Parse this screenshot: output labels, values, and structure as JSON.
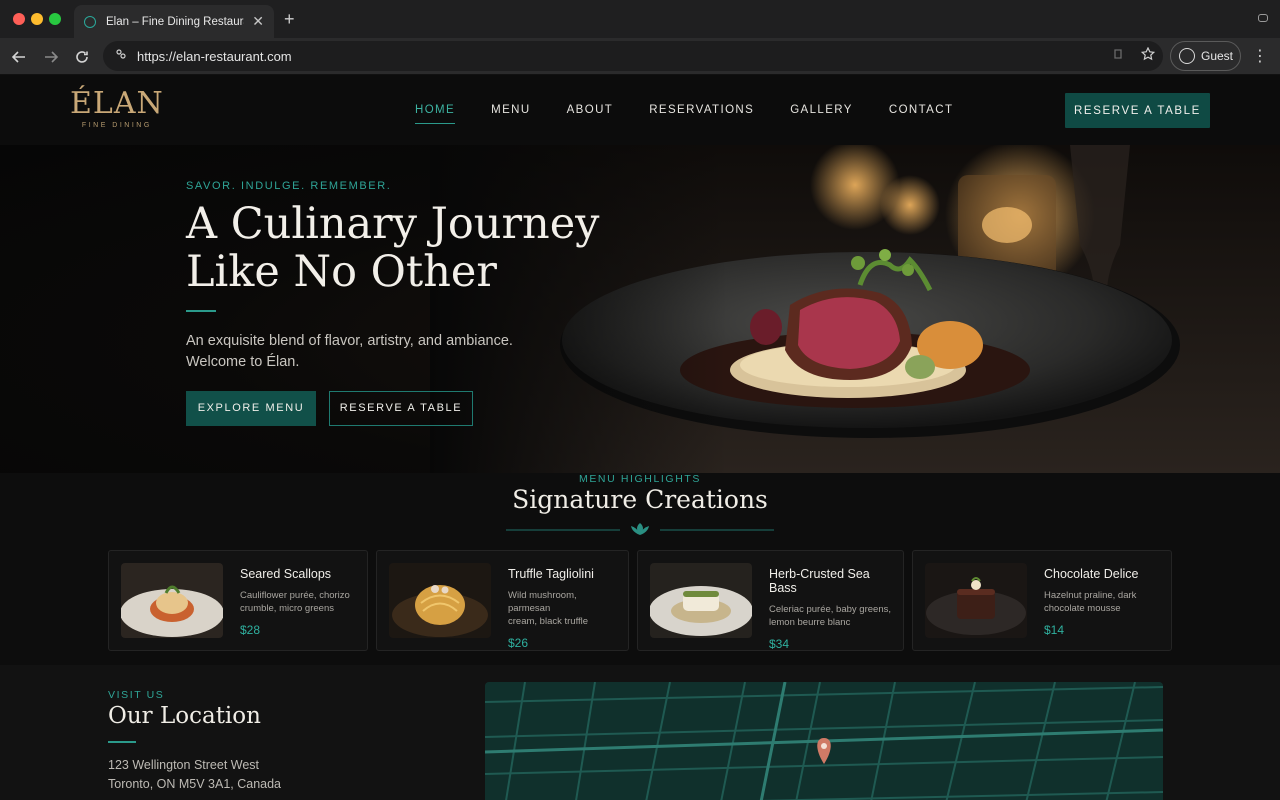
{
  "browser": {
    "tab_title": "Élan – Fine Dining Restaurant",
    "url": "https://elan-restaurant.com",
    "profile_label": "Guest"
  },
  "header": {
    "logo_main": "ÉLAN",
    "logo_sub": "FINE DINING",
    "nav": [
      {
        "label": "HOME",
        "active": true
      },
      {
        "label": "MENU",
        "active": false
      },
      {
        "label": "ABOUT",
        "active": false
      },
      {
        "label": "RESERVATIONS",
        "active": false
      },
      {
        "label": "GALLERY",
        "active": false
      },
      {
        "label": "CONTACT",
        "active": false
      }
    ],
    "cta_label": "RESERVE A TABLE"
  },
  "hero": {
    "eyebrow": "SAVOR. INDULGE. REMEMBER.",
    "title_line1": "A Culinary Journey",
    "title_line2": "Like No Other",
    "subtitle_line1": "An exquisite blend of flavor, artistry, and ambiance.",
    "subtitle_line2": "Welcome to Élan.",
    "primary_button": "EXPLORE MENU",
    "secondary_button": "RESERVE A TABLE"
  },
  "highlights": {
    "eyebrow": "MENU HIGHLIGHTS",
    "title": "Signature Creations",
    "items": [
      {
        "name": "Seared Scallops",
        "desc_line1": "Cauliflower purée, chorizo",
        "desc_line2": "crumble, micro greens",
        "price": "$28"
      },
      {
        "name": "Truffle Tagliolini",
        "desc_line1": "Wild mushroom, parmesan",
        "desc_line2": "cream, black truffle",
        "price": "$26"
      },
      {
        "name": "Herb-Crusted Sea Bass",
        "desc_line1": "Celeriac purée, baby greens,",
        "desc_line2": "lemon beurre blanc",
        "price": "$34"
      },
      {
        "name": "Chocolate Delice",
        "desc_line1": "Hazelnut praline, dark",
        "desc_line2": "chocolate mousse",
        "price": "$14"
      }
    ]
  },
  "location": {
    "eyebrow": "VISIT US",
    "title": "Our Location",
    "address_line1": "123 Wellington Street West",
    "address_line2": "Toronto, ON M5V 3A1, Canada"
  },
  "colors": {
    "accent": "#2fa597",
    "button_bg": "#115049",
    "gold": "#c9a877",
    "map_pin": "#d07a66"
  },
  "icons": [
    "back-arrow-icon",
    "forward-arrow-icon",
    "reload-icon",
    "site-info-icon",
    "extension-icon",
    "bookmark-star-icon",
    "profile-icon",
    "menu-kebab-icon",
    "leaf-icon",
    "map-pin-icon"
  ]
}
